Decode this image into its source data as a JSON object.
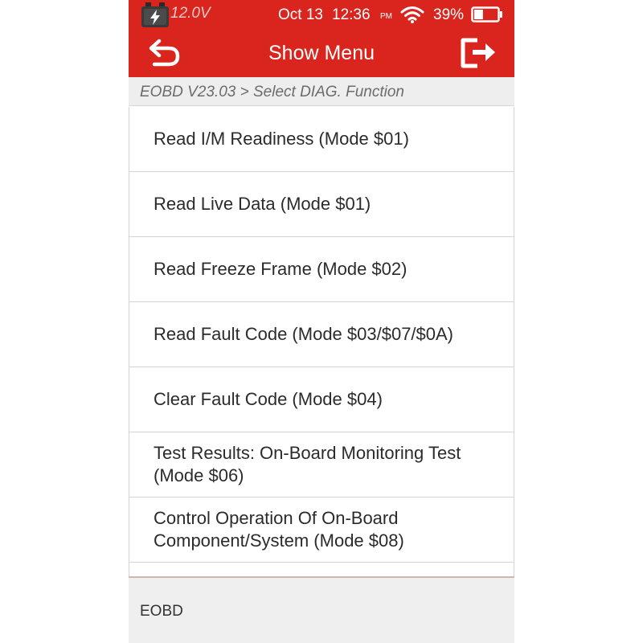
{
  "status_bar": {
    "voltage": "12.0V",
    "date": "Oct 13",
    "time": "12:36",
    "ampm": "PM",
    "battery_percent": "39%",
    "battery_level": 0.39,
    "icons": [
      "car-battery-icon",
      "wifi-icon",
      "battery-icon"
    ]
  },
  "header": {
    "title": "Show Menu",
    "back_icon": "back-arrow-icon",
    "exit_icon": "exit-icon",
    "color": "#d9251d"
  },
  "breadcrumb": "EOBD V23.03 > Select DIAG. Function",
  "menu": {
    "items": [
      {
        "label": "Read I/M Readiness (Mode $01)"
      },
      {
        "label": "Read Live Data (Mode $01)"
      },
      {
        "label": "Read Freeze Frame (Mode $02)"
      },
      {
        "label": "Read Fault Code (Mode $03/$07/$0A)"
      },
      {
        "label": "Clear Fault Code (Mode $04)"
      },
      {
        "label": "Test Results: On-Board Monitoring Test (Mode $06)"
      },
      {
        "label": "Control Operation Of On-Board Component/System (Mode $08)"
      }
    ]
  },
  "footer": {
    "label": "EOBD"
  }
}
